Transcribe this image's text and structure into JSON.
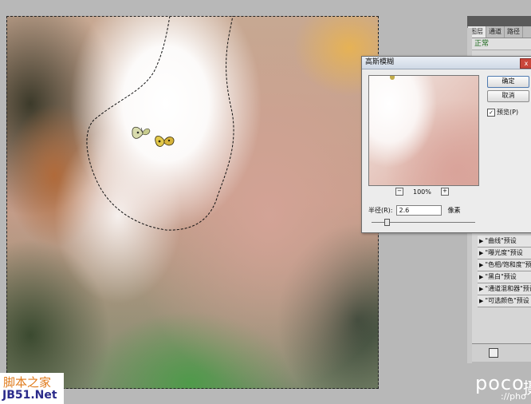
{
  "layers_panel": {
    "tabs": [
      "图层",
      "通道",
      "路径"
    ],
    "blend_mode": "正常",
    "presets": [
      "\"曲线\"预设",
      "\"曝光度\"预设",
      "\"色相/饱和度\"预设",
      "\"黑白\"预设",
      "\"通道混和器\"预设",
      "\"可选颜色\"预设"
    ]
  },
  "gaussian_blur_dialog": {
    "title": "高斯模糊",
    "close_glyph": "x",
    "ok_label": "确定",
    "cancel_label": "取消",
    "preview_checked": "✓",
    "preview_label": "预览(P)",
    "zoom_minus": "−",
    "zoom_level": "100%",
    "zoom_plus": "+",
    "radius_label": "半径(R):",
    "radius_value": "2.6",
    "radius_unit": "像素"
  },
  "watermarks": {
    "left_top": "脚本之家",
    "left_bottom": "JB51.Net",
    "right": "poco",
    "right_cut": "摄",
    "right_sub": "://pho"
  },
  "colors": {
    "accent_blue": "#4e7ab0",
    "close_red": "#c9473b",
    "blend_green": "#1c6a1c"
  }
}
